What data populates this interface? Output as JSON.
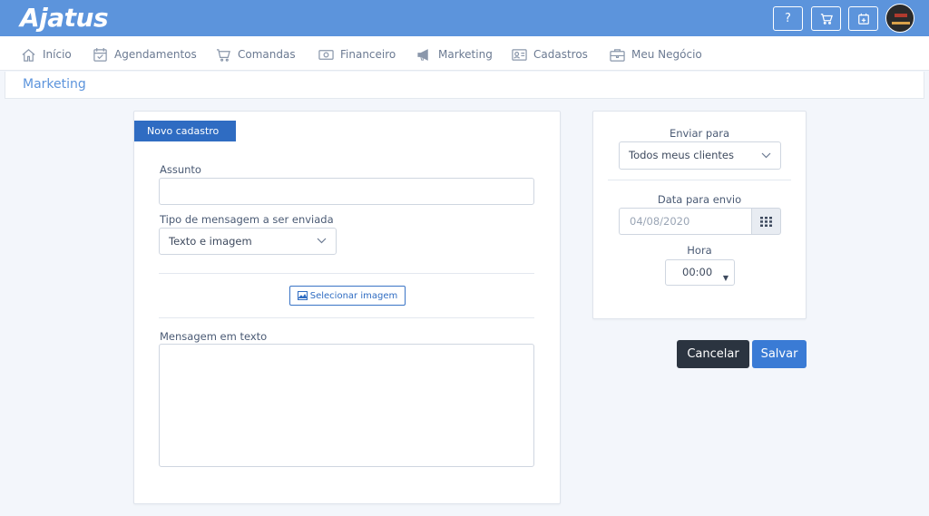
{
  "app": {
    "logo_text": "Ajatus"
  },
  "topbar": {
    "help_label": "?",
    "icons": [
      "question-icon",
      "cart-icon",
      "calendar-plus-icon",
      "user-avatar"
    ]
  },
  "nav": {
    "items": [
      {
        "label": "Início",
        "icon": "home-icon"
      },
      {
        "label": "Agendamentos",
        "icon": "calendar-check-icon"
      },
      {
        "label": "Comandas",
        "icon": "cart-icon"
      },
      {
        "label": "Financeiro",
        "icon": "money-icon"
      },
      {
        "label": "Marketing",
        "icon": "megaphone-icon"
      },
      {
        "label": "Cadastros",
        "icon": "id-card-icon"
      },
      {
        "label": "Meu Negócio",
        "icon": "briefcase-icon"
      }
    ]
  },
  "breadcrumb": {
    "title": "Marketing"
  },
  "form": {
    "tab_label": "Novo cadastro",
    "subject_label": "Assunto",
    "subject_value": "",
    "message_type_label": "Tipo de mensagem a ser enviada",
    "message_type_value": "Texto e imagem",
    "select_image_label": "Selecionar imagem",
    "text_message_label": "Mensagem em texto",
    "text_message_value": ""
  },
  "sidebar": {
    "send_to_label": "Enviar para",
    "send_to_value": "Todos meus clientes",
    "date_label": "Data para envio",
    "date_value": "04/08/2020",
    "time_label": "Hora",
    "time_value": "00:00"
  },
  "actions": {
    "cancel_label": "Cancelar",
    "save_label": "Salvar"
  },
  "colors": {
    "topbar": "#5c94dc",
    "primary": "#2f6cc2",
    "dark_button": "#2b3440"
  }
}
